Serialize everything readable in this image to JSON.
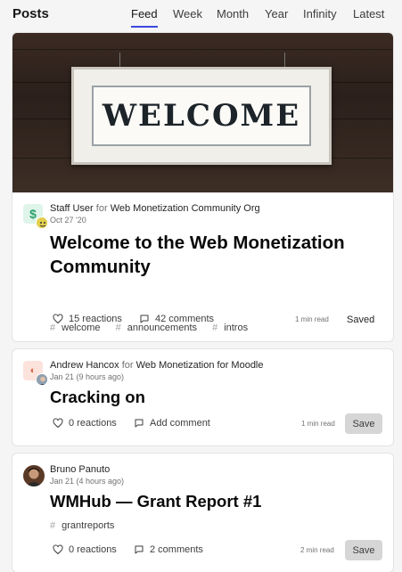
{
  "header": {
    "title": "Posts",
    "tabs": [
      {
        "label": "Feed",
        "active": true
      },
      {
        "label": "Week"
      },
      {
        "label": "Month"
      },
      {
        "label": "Year"
      },
      {
        "label": "Infinity"
      },
      {
        "label": "Latest"
      }
    ]
  },
  "posts": [
    {
      "cover": {
        "text": "WELCOME"
      },
      "author": "Staff User",
      "for_text": "for",
      "org": "Web Monetization Community Org",
      "date": "Oct 27 '20",
      "title": "Welcome to the Web Monetization Community",
      "tags": [
        "welcome",
        "announcements",
        "intros"
      ],
      "reactions": "15 reactions",
      "comments": "42 comments",
      "read_time": "1 min read",
      "save_label": "Saved"
    },
    {
      "author": "Andrew Hancox",
      "for_text": "for",
      "org": "Web Monetization for Moodle",
      "date": "Jan 21 (9 hours ago)",
      "title": "Cracking on",
      "tags": [],
      "reactions": "0 reactions",
      "comments": "Add comment",
      "read_time": "1 min read",
      "save_label": "Save"
    },
    {
      "author": "Bruno Panuto",
      "date": "Jan 21 (4 hours ago)",
      "title": "WMHub — Grant Report #1",
      "tags": [
        "grantreports"
      ],
      "reactions": "0 reactions",
      "comments": "2 comments",
      "read_time": "2 min read",
      "save_label": "Save"
    }
  ],
  "tag_prefix": "#",
  "colors": {
    "accent": "#3b49df",
    "background": "#f5f5f5",
    "card": "#ffffff",
    "save_button": "#d6d6d6"
  }
}
